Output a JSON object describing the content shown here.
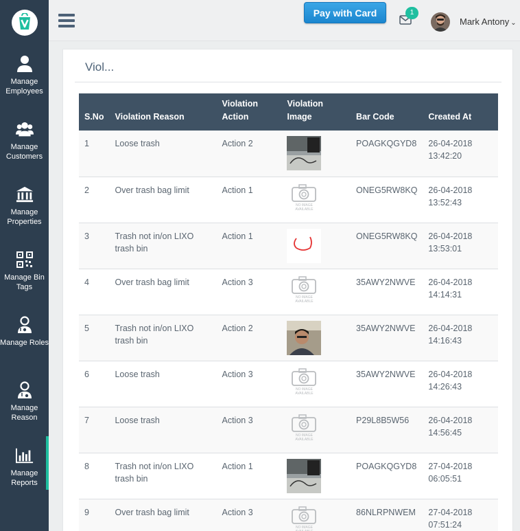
{
  "sidebar": {
    "logo_icon": "vixo-v-logo",
    "items": [
      {
        "label": "Manage Employees",
        "icon": "person-icon",
        "active": false
      },
      {
        "label": "Manage Customers",
        "icon": "group-icon",
        "active": false
      },
      {
        "label": "Manage Properties",
        "icon": "bank-icon",
        "active": false
      },
      {
        "label": "Manage Bin Tags",
        "icon": "qr-code-icon",
        "active": false
      },
      {
        "label": "Manage Roles",
        "icon": "user-roles-icon",
        "active": false
      },
      {
        "label": "Manage Reason",
        "icon": "user-reason-icon",
        "active": false
      },
      {
        "label": "Manage Reports",
        "icon": "bar-chart-icon",
        "active": true
      }
    ]
  },
  "header": {
    "pay_button": "Pay with Card",
    "notification_count": "1",
    "user_name": "Mark Antony",
    "caret": "⌄"
  },
  "panel": {
    "title": "Viol..."
  },
  "table": {
    "columns": [
      "S.No",
      "Violation Reason",
      "Violation Action",
      "Violation Image",
      "Bar Code",
      "Created At"
    ],
    "no_image_text": "NO IMAGE AVAILABLE",
    "rows": [
      {
        "sno": "1",
        "reason": "Loose trash",
        "action": "Action 2",
        "image": "photo-desk",
        "barcode": "POAGKQGYD8",
        "date": "26-04-2018",
        "time": "13:42:20"
      },
      {
        "sno": "2",
        "reason": "Over trash bag limit",
        "action": "Action 1",
        "image": "none",
        "barcode": "ONEG5RW8KQ",
        "date": "26-04-2018",
        "time": "13:52:43"
      },
      {
        "sno": "3",
        "reason": "Trash not in/on LIXO trash bin",
        "action": "Action 1",
        "image": "photo-red-circle",
        "barcode": "ONEG5RW8KQ",
        "date": "26-04-2018",
        "time": "13:53:01"
      },
      {
        "sno": "4",
        "reason": "Over trash bag limit",
        "action": "Action 3",
        "image": "none",
        "barcode": "35AWY2NWVE",
        "date": "26-04-2018",
        "time": "14:14:31"
      },
      {
        "sno": "5",
        "reason": "Trash not in/on LIXO trash bin",
        "action": "Action 2",
        "image": "photo-person",
        "barcode": "35AWY2NWVE",
        "date": "26-04-2018",
        "time": "14:16:43"
      },
      {
        "sno": "6",
        "reason": "Loose trash",
        "action": "Action 3",
        "image": "none",
        "barcode": "35AWY2NWVE",
        "date": "26-04-2018",
        "time": "14:26:43"
      },
      {
        "sno": "7",
        "reason": "Loose trash",
        "action": "Action 3",
        "image": "none",
        "barcode": "P29L8B5W56",
        "date": "26-04-2018",
        "time": "14:56:45"
      },
      {
        "sno": "8",
        "reason": "Trash not in/on LIXO trash bin",
        "action": "Action 1",
        "image": "photo-desk",
        "barcode": "POAGKQGYD8",
        "date": "27-04-2018",
        "time": "06:05:51"
      },
      {
        "sno": "9",
        "reason": "Over trash bag limit",
        "action": "Action 3",
        "image": "none",
        "barcode": "86NLRPNWEM",
        "date": "27-04-2018",
        "time": "07:51:24"
      }
    ]
  },
  "colors": {
    "sidebar": "#2d3e4f",
    "table_header": "#3f5264",
    "accent": "#1fbfa0",
    "button": "#1b86cf"
  }
}
